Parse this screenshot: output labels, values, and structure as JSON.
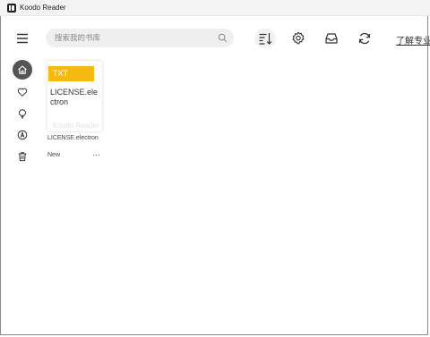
{
  "window": {
    "title": "Koodo Reader",
    "app_icon": "koodo-app-icon"
  },
  "header": {
    "menu_icon": "hamburger-menu-icon",
    "search": {
      "placeholder": "搜索我的书库",
      "value": "",
      "icon": "search-icon"
    },
    "toolbar": [
      {
        "name": "sort-button",
        "icon": "sort-icon"
      },
      {
        "name": "settings-button",
        "icon": "gear-icon"
      },
      {
        "name": "inbox-button",
        "icon": "inbox-icon"
      },
      {
        "name": "sync-button",
        "icon": "sync-icon"
      }
    ],
    "pro_link": "了解专业版"
  },
  "sidebar": {
    "items": [
      {
        "name": "home",
        "icon": "home-icon",
        "active": true
      },
      {
        "name": "favorites",
        "icon": "heart-icon",
        "active": false
      },
      {
        "name": "notes",
        "icon": "lightbulb-icon",
        "active": false
      },
      {
        "name": "highlights",
        "icon": "pen-circle-icon",
        "active": false
      },
      {
        "name": "trash",
        "icon": "trash-icon",
        "active": false
      }
    ]
  },
  "library": {
    "books": [
      {
        "format": "TXT",
        "cover_title": "LICENSE.electron",
        "cover_watermark": "Koodo Reader",
        "title": "LICENSE.electron",
        "status": "New",
        "more": "···"
      }
    ]
  },
  "colors": {
    "tag": "#f5b912",
    "active_nav": "#555555",
    "search_bg": "#efefef"
  }
}
